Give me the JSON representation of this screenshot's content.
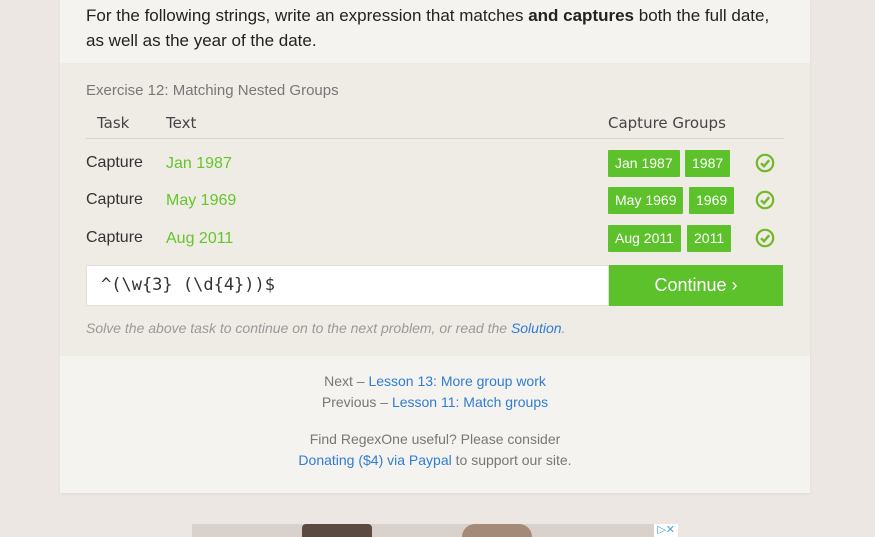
{
  "intro": {
    "prefix": "For the following strings, write an expression that matches ",
    "bold": "and captures",
    "suffix": " both the full date, as well as the year of the date."
  },
  "exercise": {
    "title": "Exercise 12: Matching Nested Groups",
    "headers": {
      "task": "Task",
      "text": "Text",
      "capture_groups": "Capture Groups"
    },
    "rows": [
      {
        "task": "Capture",
        "text": "Jan 1987",
        "groups": [
          "Jan 1987",
          "1987"
        ],
        "status": "check-icon"
      },
      {
        "task": "Capture",
        "text": "May 1969",
        "groups": [
          "May 1969",
          "1969"
        ],
        "status": "check-icon"
      },
      {
        "task": "Capture",
        "text": "Aug 2011",
        "groups": [
          "Aug 2011",
          "2011"
        ],
        "status": "check-icon"
      }
    ],
    "input_value": "^(\\w{3} (\\d{4}))$",
    "continue_label": "Continue ›",
    "hint_prefix": "Solve the above task to continue on to the next problem, or read the ",
    "hint_link": "Solution",
    "hint_suffix": "."
  },
  "footer": {
    "next_prefix": "Next – ",
    "next_link": "Lesson 13: More group work",
    "prev_prefix": "Previous – ",
    "prev_link": "Lesson 11: Match groups",
    "support_text": "Find RegexOne useful? Please consider",
    "donate_link": "Donating ($4) via Paypal",
    "donate_suffix": " to support our site."
  },
  "ad": {
    "icons": "▷✕"
  },
  "colors": {
    "accent_green": "#5cc12a",
    "text_green": "#66c52a",
    "link_blue": "#2f7cd5"
  }
}
